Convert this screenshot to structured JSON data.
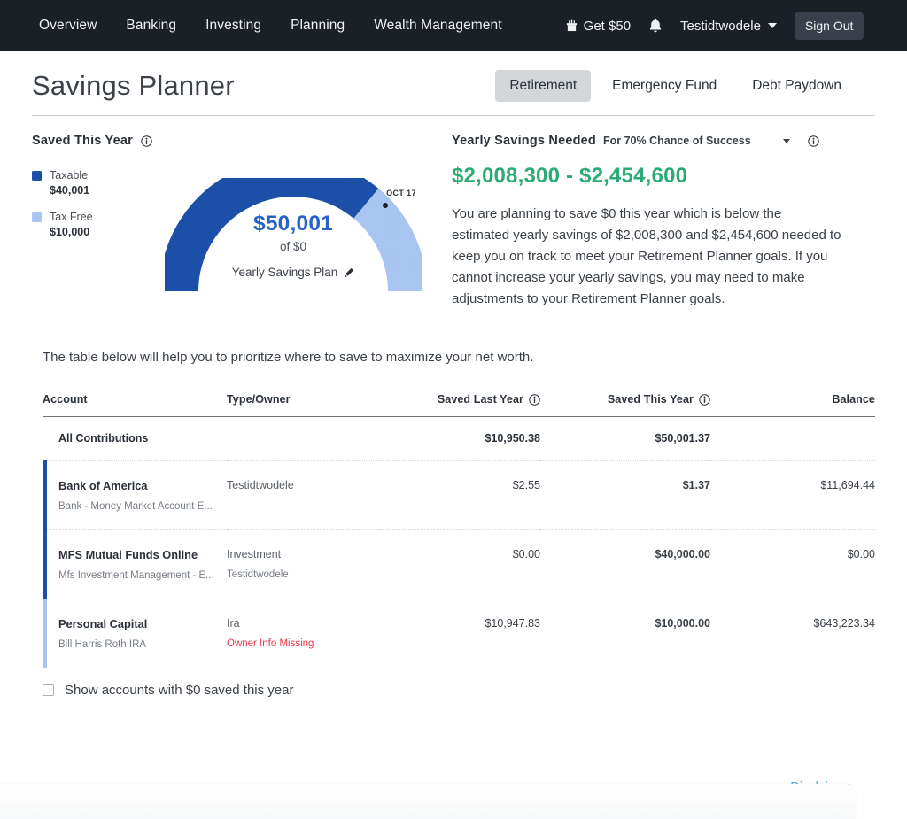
{
  "nav": {
    "links": [
      {
        "label": "Overview"
      },
      {
        "label": "Banking"
      },
      {
        "label": "Investing"
      },
      {
        "label": "Planning"
      },
      {
        "label": "Wealth Management"
      }
    ],
    "get_offer_label": "Get $50",
    "gift_icon": "gift-icon",
    "bell_icon": "bell-icon",
    "user_name": "Testidtwodele",
    "sign_out_label": "Sign Out"
  },
  "page": {
    "title": "Savings Planner",
    "tabs": [
      {
        "label": "Retirement",
        "active": true
      },
      {
        "label": "Emergency Fund",
        "active": false
      },
      {
        "label": "Debt Paydown",
        "active": false
      }
    ]
  },
  "saved_panel": {
    "title": "Saved This Year",
    "info_icon": "info-icon",
    "legend": [
      {
        "label": "Taxable",
        "value": "$40,001",
        "color": "#1b4fa8"
      },
      {
        "label": "Tax Free",
        "value": "$10,000",
        "color": "#a8c6f0"
      }
    ]
  },
  "gauge": {
    "amount": "$50,001",
    "of_label": "of $0",
    "plan_label": "Yearly Savings Plan",
    "edit_icon": "pencil-icon",
    "marker_label": "OCT 17"
  },
  "chart_data": {
    "type": "pie",
    "title": "Saved This Year",
    "subtitle": "Yearly Savings Plan gauge",
    "categories": [
      "Taxable",
      "Tax Free"
    ],
    "values": [
      40001,
      10000
    ],
    "value_labels": [
      "$40,001",
      "$10,000"
    ],
    "colors": [
      "#1b4fa8",
      "#a8c6f0"
    ],
    "total": 50001,
    "total_label": "$50,001",
    "goal": 0,
    "goal_label": "of $0",
    "gauge_start_angle": 180,
    "gauge_end_angle": 360,
    "marker": {
      "label": "OCT 17",
      "position_pct": 80
    },
    "legend": "left"
  },
  "savings_needed": {
    "title": "Yearly Savings Needed",
    "subtitle": "For 70% Chance of Success",
    "dropdown_icon": "chevron-down-icon",
    "info_icon": "info-icon",
    "range": "$2,008,300 - $2,454,600",
    "body": "You are planning to save $0 this year which is below the estimated yearly savings of $2,008,300 and $2,454,600 needed to keep you on track to meet your Retirement Planner goals. If you cannot increase your yearly savings, you may need to make adjustments to your Retirement Planner goals.",
    "range_color": "#2aab73"
  },
  "table": {
    "intro": "The table below will help you to prioritize where to save to maximize your net worth.",
    "headers": {
      "account": "Account",
      "type_owner": "Type/Owner",
      "saved_last_year": "Saved Last Year",
      "saved_this_year": "Saved This Year",
      "balance": "Balance"
    },
    "totals": {
      "label": "All Contributions",
      "saved_last_year": "$10,950.38",
      "saved_this_year": "$50,001.37"
    },
    "rows": [
      {
        "name": "Bank of America",
        "desc": "Bank - Money Market Account E...",
        "type": "Testidtwodele",
        "type_sub": "",
        "type_sub_warn": false,
        "saved_last_year": "$2.55",
        "saved_this_year": "$1.37",
        "balance": "$11,694.44",
        "bar_color": "#1b4fa8"
      },
      {
        "name": "MFS Mutual Funds Online",
        "desc": "Mfs Investment Management - E...",
        "type": "Investment",
        "type_sub": "Testidtwodele",
        "type_sub_warn": false,
        "saved_last_year": "$0.00",
        "saved_this_year": "$40,000.00",
        "balance": "$0.00",
        "bar_color": "#1b4fa8"
      },
      {
        "name": "Personal Capital",
        "desc": "Bill Harris Roth IRA",
        "type": "Ira",
        "type_sub": "Owner Info Missing",
        "type_sub_warn": true,
        "saved_last_year": "$10,947.83",
        "saved_this_year": "$10,000.00",
        "balance": "$643,223.34",
        "bar_color": "#a8c6f0"
      }
    ]
  },
  "show_zero": {
    "label": "Show accounts with $0 saved this year",
    "checked": false
  },
  "footer": {
    "disclaimer_label": "Disclaimer"
  }
}
